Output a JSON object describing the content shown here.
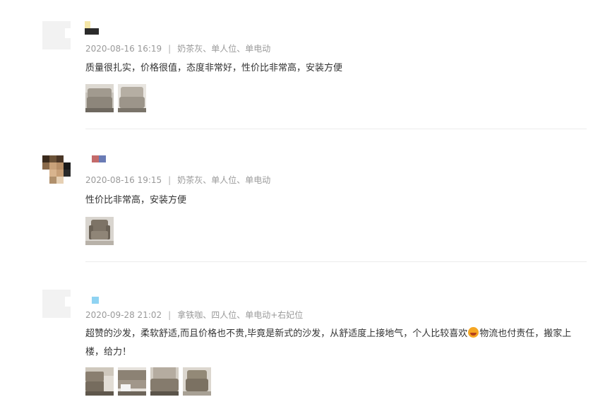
{
  "reviews": [
    {
      "date": "2020-08-16 16:19",
      "separator": "|",
      "specs": "奶茶灰、单人位、单电动",
      "content": "质量很扎实，价格很值，态度非常好，性价比非常高，安装方便",
      "photo_count": 2
    },
    {
      "date": "2020-08-16 19:15",
      "separator": "|",
      "specs": "奶茶灰、单人位、单电动",
      "content": "性价比非常高，安装方便",
      "photo_count": 1
    },
    {
      "date": "2020-09-28 21:02",
      "separator": "|",
      "specs": "拿铁咖、四人位、单电动+右妃位",
      "content_part1": "超赞的沙发，柔软舒适,而且价格也不贵,毕竟是新式的沙发，从舒适度上接地气，个人比较喜欢",
      "content_part2": "物流也付责任，搬家上楼，给力！",
      "emoji": "smiling-face-heart-eyes-icon",
      "photo_count": 4
    }
  ]
}
